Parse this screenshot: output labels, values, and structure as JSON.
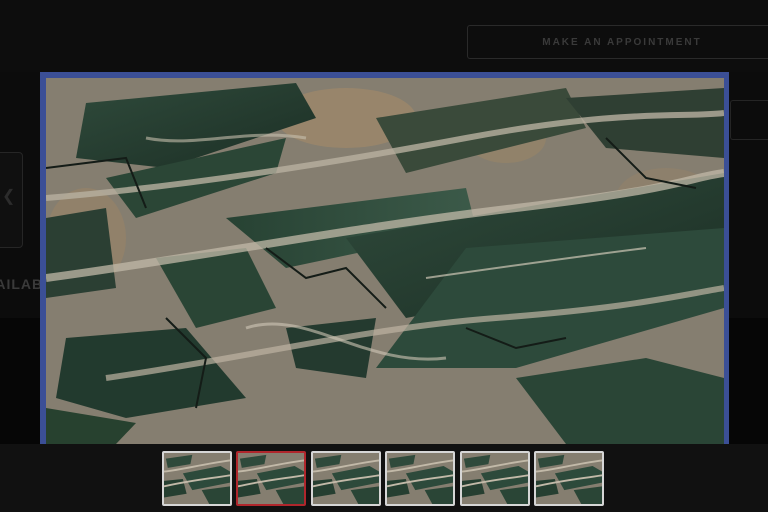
{
  "background_page": {
    "appointment_button_label": "MAKE AN APPOINTMENT",
    "available_text": "AVAILABLE"
  },
  "lightbox": {
    "frame_color": "#3b4f96",
    "image_subject": "green quartzite slab with beige veining",
    "thumbnails": [
      {
        "active": false
      },
      {
        "active": true
      },
      {
        "active": false
      },
      {
        "active": false
      },
      {
        "active": false
      },
      {
        "active": false
      }
    ],
    "active_border_color": "#b0262c",
    "thumb_border_color": "#d6d6d6"
  }
}
